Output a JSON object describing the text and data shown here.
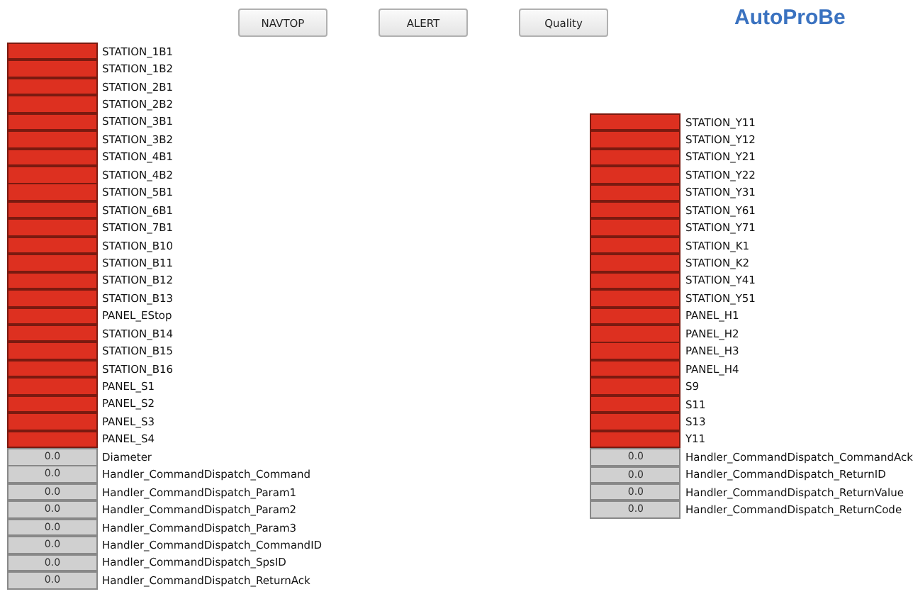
{
  "toolbar": {
    "buttons": [
      "NAVTOP",
      "ALERT",
      "Quality"
    ],
    "logo": "AutoProBe"
  },
  "left_column": [
    {
      "kind": "indicator",
      "label": "STATION_1B1"
    },
    {
      "kind": "indicator",
      "label": "STATION_1B2"
    },
    {
      "kind": "indicator",
      "label": "STATION_2B1"
    },
    {
      "kind": "indicator",
      "label": "STATION_2B2"
    },
    {
      "kind": "indicator",
      "label": "STATION_3B1"
    },
    {
      "kind": "indicator",
      "label": "STATION_3B2"
    },
    {
      "kind": "indicator",
      "label": "STATION_4B1"
    },
    {
      "kind": "indicator",
      "label": "STATION_4B2"
    },
    {
      "kind": "indicator",
      "label": "STATION_5B1"
    },
    {
      "kind": "indicator",
      "label": "STATION_6B1"
    },
    {
      "kind": "indicator",
      "label": "STATION_7B1"
    },
    {
      "kind": "indicator",
      "label": "STATION_B10"
    },
    {
      "kind": "indicator",
      "label": "STATION_B11"
    },
    {
      "kind": "indicator",
      "label": "STATION_B12"
    },
    {
      "kind": "indicator",
      "label": "STATION_B13"
    },
    {
      "kind": "indicator",
      "label": "PANEL_EStop"
    },
    {
      "kind": "indicator",
      "label": "STATION_B14"
    },
    {
      "kind": "indicator",
      "label": "STATION_B15"
    },
    {
      "kind": "indicator",
      "label": "STATION_B16"
    },
    {
      "kind": "indicator",
      "label": "PANEL_S1"
    },
    {
      "kind": "indicator",
      "label": "PANEL_S2"
    },
    {
      "kind": "indicator",
      "label": "PANEL_S3"
    },
    {
      "kind": "indicator",
      "label": "PANEL_S4"
    },
    {
      "kind": "value",
      "value": "0.0",
      "label": "Diameter"
    },
    {
      "kind": "value",
      "value": "0.0",
      "label": "Handler_CommandDispatch_Command"
    },
    {
      "kind": "value",
      "value": "0.0",
      "label": "Handler_CommandDispatch_Param1"
    },
    {
      "kind": "value",
      "value": "0.0",
      "label": "Handler_CommandDispatch_Param2"
    },
    {
      "kind": "value",
      "value": "0.0",
      "label": "Handler_CommandDispatch_Param3"
    },
    {
      "kind": "value",
      "value": "0.0",
      "label": "Handler_CommandDispatch_CommandID"
    },
    {
      "kind": "value",
      "value": "0.0",
      "label": "Handler_CommandDispatch_SpsID"
    },
    {
      "kind": "value",
      "value": "0.0",
      "label": "Handler_CommandDispatch_ReturnAck"
    }
  ],
  "right_column": [
    {
      "kind": "indicator",
      "label": "STATION_Y11"
    },
    {
      "kind": "indicator",
      "label": "STATION_Y12"
    },
    {
      "kind": "indicator",
      "label": "STATION_Y21"
    },
    {
      "kind": "indicator",
      "label": "STATION_Y22"
    },
    {
      "kind": "indicator",
      "label": "STATION_Y31"
    },
    {
      "kind": "indicator",
      "label": "STATION_Y61"
    },
    {
      "kind": "indicator",
      "label": "STATION_Y71"
    },
    {
      "kind": "indicator",
      "label": "STATION_K1"
    },
    {
      "kind": "indicator",
      "label": "STATION_K2"
    },
    {
      "kind": "indicator",
      "label": "STATION_Y41"
    },
    {
      "kind": "indicator",
      "label": "STATION_Y51"
    },
    {
      "kind": "indicator",
      "label": "PANEL_H1"
    },
    {
      "kind": "indicator",
      "label": "PANEL_H2"
    },
    {
      "kind": "indicator",
      "label": "PANEL_H3"
    },
    {
      "kind": "indicator",
      "label": "PANEL_H4"
    },
    {
      "kind": "indicator",
      "label": "S9"
    },
    {
      "kind": "indicator",
      "label": "S11"
    },
    {
      "kind": "indicator",
      "label": "S13"
    },
    {
      "kind": "indicator",
      "label": "Y11"
    },
    {
      "kind": "value",
      "value": "0.0",
      "label": "Handler_CommandDispatch_CommandAck"
    },
    {
      "kind": "value",
      "value": "0.0",
      "label": "Handler_CommandDispatch_ReturnID"
    },
    {
      "kind": "value",
      "value": "0.0",
      "label": "Handler_CommandDispatch_ReturnValue"
    },
    {
      "kind": "value",
      "value": "0.0",
      "label": "Handler_CommandDispatch_ReturnCode"
    }
  ]
}
